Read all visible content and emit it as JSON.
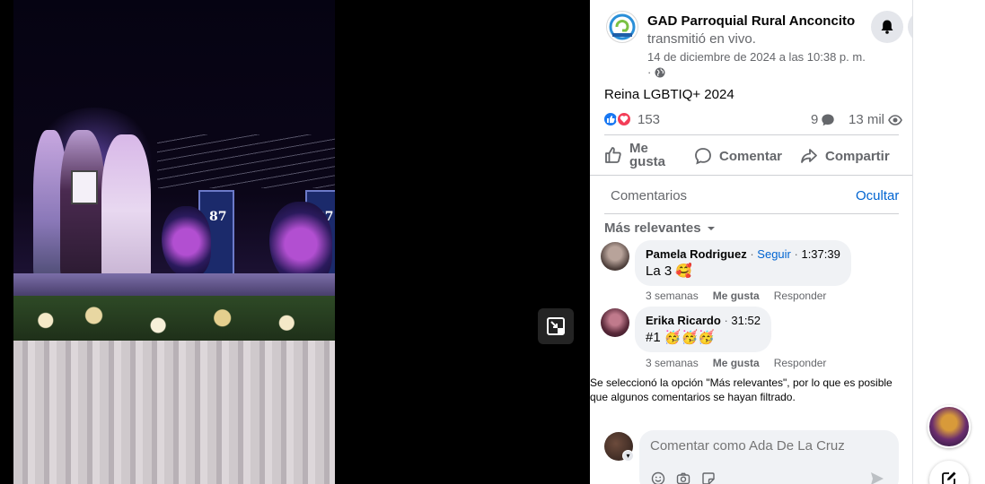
{
  "post": {
    "page_name": "GAD Parroquial Rural Anconcito",
    "action_text": "transmitió en vivo.",
    "date": "14 de diciembre de 2024 a las 10:38 p. m.",
    "dot": "·",
    "caption": "Reina LGBTIQ+ 2024",
    "reaction_count": "153",
    "comment_count": "9",
    "view_count": "13 mil"
  },
  "actions": {
    "like": "Me gusta",
    "comment": "Comentar",
    "share": "Compartir"
  },
  "comments_section": {
    "header": "Comentarios",
    "hide": "Ocultar",
    "sort": "Más relevantes",
    "items": [
      {
        "name": "Pamela Rodriguez",
        "follow": "Seguir",
        "sep": "·",
        "time": "1:37:39",
        "text": "La 3 🥰",
        "age": "3 semanas",
        "like": "Me gusta",
        "reply": "Responder"
      },
      {
        "name": "Erika Ricardo",
        "sep": "·",
        "time": "31:52",
        "text": "#1 🥳🥳🥳",
        "age": "3 semanas",
        "like": "Me gusta",
        "reply": "Responder"
      }
    ],
    "filter_note": "Se seleccionó la opción \"Más relevantes\", por lo que es posible que algunos comentarios se hayan filtrado.",
    "input_placeholder": "Comentar como Ada De La Cruz"
  },
  "video": {
    "panel_number": "87"
  },
  "colors": {
    "link": "#0064d1",
    "like_blue": "#1877f2",
    "love_red": "#f33e58"
  },
  "icons": [
    "bell-icon",
    "globe-icon",
    "like-icon",
    "comment-icon",
    "share-icon",
    "eye-icon",
    "chevron-down-icon",
    "exit-fullscreen-icon",
    "emoji-icon",
    "camera-icon",
    "sticker-icon",
    "send-icon",
    "compose-icon"
  ]
}
